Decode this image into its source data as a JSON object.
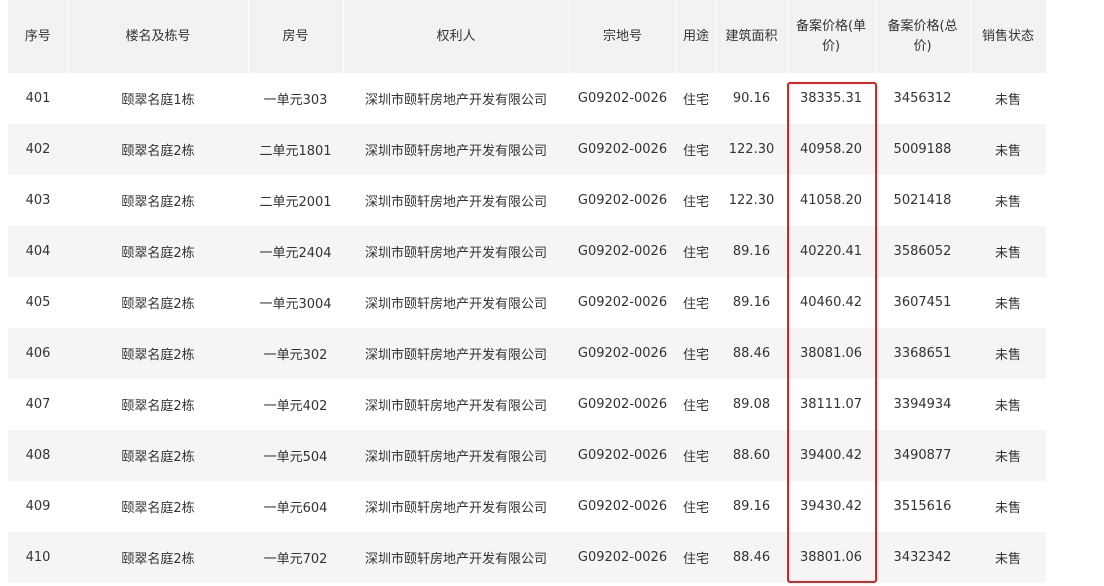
{
  "table": {
    "headers": {
      "seq": "序号",
      "building": "楼名及栋号",
      "room": "房号",
      "owner": "权利人",
      "parcel": "宗地号",
      "use": "用途",
      "area": "建筑面积",
      "unit_price": "备案价格(单价)",
      "total_price": "备案价格(总价)",
      "status": "销售状态"
    },
    "rows": [
      {
        "seq": "401",
        "building": "颐翠名庭1栋",
        "room": "一单元303",
        "owner": "深圳市颐轩房地产开发有限公司",
        "parcel": "G09202-0026",
        "use": "住宅",
        "area": "90.16",
        "unit_price": "38335.31",
        "total_price": "3456312",
        "status": "未售"
      },
      {
        "seq": "402",
        "building": "颐翠名庭2栋",
        "room": "二单元1801",
        "owner": "深圳市颐轩房地产开发有限公司",
        "parcel": "G09202-0026",
        "use": "住宅",
        "area": "122.30",
        "unit_price": "40958.20",
        "total_price": "5009188",
        "status": "未售"
      },
      {
        "seq": "403",
        "building": "颐翠名庭2栋",
        "room": "二单元2001",
        "owner": "深圳市颐轩房地产开发有限公司",
        "parcel": "G09202-0026",
        "use": "住宅",
        "area": "122.30",
        "unit_price": "41058.20",
        "total_price": "5021418",
        "status": "未售"
      },
      {
        "seq": "404",
        "building": "颐翠名庭2栋",
        "room": "一单元2404",
        "owner": "深圳市颐轩房地产开发有限公司",
        "parcel": "G09202-0026",
        "use": "住宅",
        "area": "89.16",
        "unit_price": "40220.41",
        "total_price": "3586052",
        "status": "未售"
      },
      {
        "seq": "405",
        "building": "颐翠名庭2栋",
        "room": "一单元3004",
        "owner": "深圳市颐轩房地产开发有限公司",
        "parcel": "G09202-0026",
        "use": "住宅",
        "area": "89.16",
        "unit_price": "40460.42",
        "total_price": "3607451",
        "status": "未售"
      },
      {
        "seq": "406",
        "building": "颐翠名庭2栋",
        "room": "一单元302",
        "owner": "深圳市颐轩房地产开发有限公司",
        "parcel": "G09202-0026",
        "use": "住宅",
        "area": "88.46",
        "unit_price": "38081.06",
        "total_price": "3368651",
        "status": "未售"
      },
      {
        "seq": "407",
        "building": "颐翠名庭2栋",
        "room": "一单元402",
        "owner": "深圳市颐轩房地产开发有限公司",
        "parcel": "G09202-0026",
        "use": "住宅",
        "area": "89.08",
        "unit_price": "38111.07",
        "total_price": "3394934",
        "status": "未售"
      },
      {
        "seq": "408",
        "building": "颐翠名庭2栋",
        "room": "一单元504",
        "owner": "深圳市颐轩房地产开发有限公司",
        "parcel": "G09202-0026",
        "use": "住宅",
        "area": "88.60",
        "unit_price": "39400.42",
        "total_price": "3490877",
        "status": "未售"
      },
      {
        "seq": "409",
        "building": "颐翠名庭2栋",
        "room": "一单元604",
        "owner": "深圳市颐轩房地产开发有限公司",
        "parcel": "G09202-0026",
        "use": "住宅",
        "area": "89.16",
        "unit_price": "39430.42",
        "total_price": "3515616",
        "status": "未售"
      },
      {
        "seq": "410",
        "building": "颐翠名庭2栋",
        "room": "一单元702",
        "owner": "深圳市颐轩房地产开发有限公司",
        "parcel": "G09202-0026",
        "use": "住宅",
        "area": "88.46",
        "unit_price": "38801.06",
        "total_price": "3432342",
        "status": "未售"
      }
    ]
  },
  "colors": {
    "header_bg": "#f2f2f2",
    "row_alt_bg": "#f5f5f5",
    "highlight_border": "#e02020"
  }
}
